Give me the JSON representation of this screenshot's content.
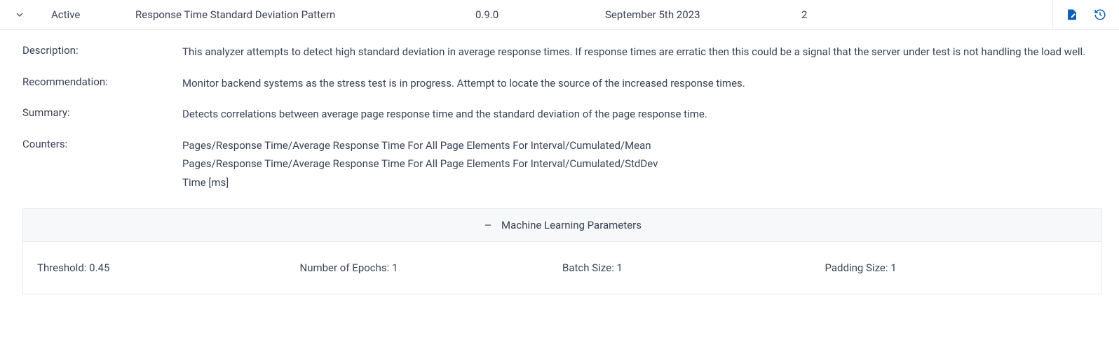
{
  "row": {
    "status": "Active",
    "name": "Response Time Standard Deviation Pattern",
    "version": "0.9.0",
    "date": "September 5th 2023",
    "count": "2"
  },
  "labels": {
    "description": "Description:",
    "recommendation": "Recommendation:",
    "summary": "Summary:",
    "counters": "Counters:"
  },
  "details": {
    "description": "This analyzer attempts to detect high standard deviation in average response times. If response times are erratic then this could be a signal that the server under test is not handling the load well.",
    "recommendation": "Monitor backend systems as the stress test is in progress. Attempt to locate the source of the increased response times.",
    "summary": "Detects correlations between average page response time and the standard deviation of the page response time.",
    "counters": {
      "line1": "Pages/Response Time/Average Response Time For All Page Elements For Interval/Cumulated/Mean",
      "line2": "Pages/Response Time/Average Response Time For All Page Elements For Interval/Cumulated/StdDev",
      "line3": "Time [ms]"
    }
  },
  "ml": {
    "title": "Machine Learning Parameters",
    "threshold_label": "Threshold:",
    "threshold_value": " 0.45",
    "epochs_label": "Number of Epochs:",
    "epochs_value": " 1",
    "batch_label": "Batch Size:",
    "batch_value": " 1",
    "padding_label": "Padding Size:",
    "padding_value": " 1"
  }
}
